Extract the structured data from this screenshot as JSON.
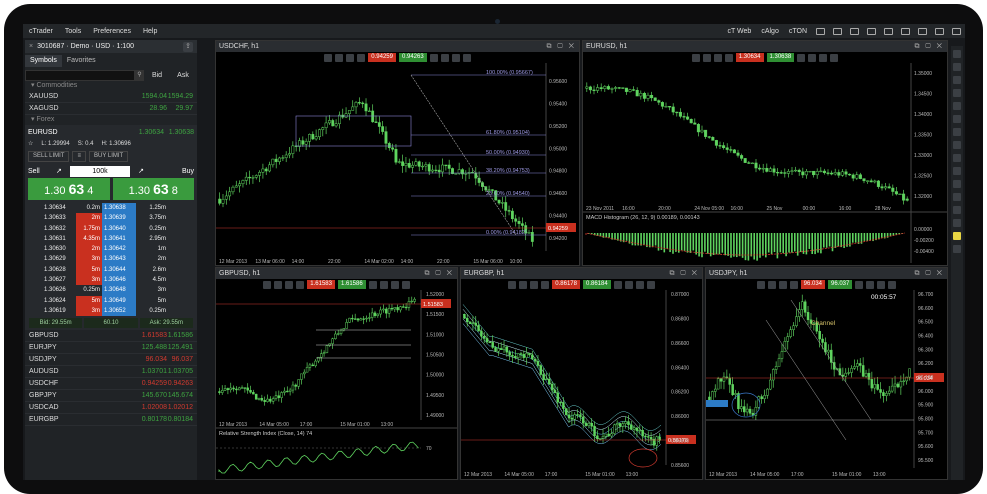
{
  "menu": {
    "ctrader": "cTrader",
    "tools": "Tools",
    "prefs": "Preferences",
    "help": "Help",
    "ctweb": "cT Web",
    "calgo": "cAlgo",
    "cton": "cTON"
  },
  "account": {
    "label": "3010687 · Demo · USD · 1:100"
  },
  "tabs": {
    "symbols": "Symbols",
    "favorites": "Favorites"
  },
  "search": {
    "placeholder": "",
    "bid": "Bid",
    "ask": "Ask"
  },
  "groups": {
    "commodities": "▾ Commodities",
    "forex": "▾ Forex"
  },
  "commodities": [
    {
      "name": "XAUUSD",
      "bid": "1594.04",
      "ask": "1594.29"
    },
    {
      "name": "XAGUSD",
      "bid": "28.96",
      "ask": "29.97"
    }
  ],
  "eurusd": {
    "name": "EURUSD",
    "bid": "1.30634",
    "ask": "1.30638",
    "low": "L: 1.29994",
    "spread": "S: 0.4",
    "high": "H: 1.30696",
    "sell_limit": "SELL LIMIT",
    "buy_limit": "BUY LIMIT",
    "sell": "Sell",
    "buy": "Buy",
    "qty": "100k",
    "bigsell_pre": "1.30",
    "bigsell_mid": "63",
    "bigsell_post": "4",
    "bigbuy_pre": "1.30",
    "bigbuy_mid": "63",
    "bigbuy_post": "8"
  },
  "ladder": [
    {
      "bpx": "1.30634",
      "bvol": "0.2m",
      "apx": "1.30638",
      "avol": "1.25m",
      "bred": false
    },
    {
      "bpx": "1.30633",
      "bvol": "2m",
      "apx": "1.30639",
      "avol": "3.75m",
      "bred": true
    },
    {
      "bpx": "1.30632",
      "bvol": "1.75m",
      "apx": "1.30640",
      "avol": "0.25m",
      "bred": true
    },
    {
      "bpx": "1.30631",
      "bvol": "4.35m",
      "apx": "1.30641",
      "avol": "2.95m",
      "bred": true
    },
    {
      "bpx": "1.30630",
      "bvol": "2m",
      "apx": "1.30642",
      "avol": "1m",
      "bred": true
    },
    {
      "bpx": "1.30629",
      "bvol": "3m",
      "apx": "1.30643",
      "avol": "2m",
      "bred": true
    },
    {
      "bpx": "1.30628",
      "bvol": "5m",
      "apx": "1.30644",
      "avol": "2.6m",
      "bred": true
    },
    {
      "bpx": "1.30627",
      "bvol": "3m",
      "apx": "1.30646",
      "avol": "4.5m",
      "bred": true
    },
    {
      "bpx": "1.30626",
      "bvol": "0.25m",
      "apx": "1.30648",
      "avol": "3m",
      "bred": false
    },
    {
      "bpx": "1.30624",
      "bvol": "5m",
      "apx": "1.30649",
      "avol": "5m",
      "bred": true
    },
    {
      "bpx": "1.30619",
      "bvol": "3m",
      "apx": "1.30652",
      "avol": "0.25m",
      "bred": true
    }
  ],
  "spread": {
    "bid": "Bid: 29.55m",
    "mid": "60.10",
    "ask": "Ask: 29.55m"
  },
  "forex": [
    {
      "name": "GBPUSD",
      "bid": "1.61583",
      "ask": "1.61586",
      "bc": "rd",
      "ac": "gr"
    },
    {
      "name": "EURJPY",
      "bid": "125.488",
      "ask": "125.491",
      "bc": "gr",
      "ac": "gr"
    },
    {
      "name": "USDJPY",
      "bid": "96.034",
      "ask": "96.037",
      "bc": "rd",
      "ac": "rd"
    },
    {
      "name": "AUDUSD",
      "bid": "1.03701",
      "ask": "1.03705",
      "bc": "gr",
      "ac": "gr"
    },
    {
      "name": "USDCHF",
      "bid": "0.94259",
      "ask": "0.94263",
      "bc": "rd",
      "ac": "rd"
    },
    {
      "name": "GBPJPY",
      "bid": "145.670",
      "ask": "145.674",
      "bc": "gr",
      "ac": "gr"
    },
    {
      "name": "USDCAD",
      "bid": "1.02008",
      "ask": "1.02012",
      "bc": "rd",
      "ac": "rd"
    },
    {
      "name": "EURGBP",
      "bid": "0.80178",
      "ask": "0.80184",
      "bc": "gr",
      "ac": "gr"
    }
  ],
  "charts": {
    "usdchf": {
      "title": "USDCHF, h1",
      "sell": "0.94259",
      "buy": "0.94263",
      "ticks": [
        "0.95600",
        "0.95400",
        "0.95200",
        "0.95000",
        "0.94800",
        "0.94600",
        "0.94400",
        "0.94200"
      ],
      "times": [
        "12 Mar 2013",
        "13 Mar 06:00",
        "14:00",
        "22:00",
        "14 Mar 02:00",
        "14:00",
        "22:00",
        "15 Mar 06:00",
        "10:00"
      ],
      "fib": [
        "100.00% (0.95667)",
        "61.80% (0.95104)",
        "50.00% (0.94930)",
        "38.20% (0.94753)",
        "23.60% (0.94540)",
        "0.00% (0.94182)"
      ],
      "price": "0.94259"
    },
    "eurusd": {
      "title": "EURUSD, h1",
      "sell": "1.30634",
      "buy": "1.30638",
      "ticks": [
        "1.35000",
        "1.34500",
        "1.34000",
        "1.33500",
        "1.33000",
        "1.32500",
        "1.32000"
      ],
      "times": [
        "23 Nov 2011",
        "16:00",
        "20:00",
        "24 Nov 05:00",
        "16:00",
        "25 Nov",
        "00:00",
        "16:00",
        "28 Nov"
      ],
      "macd": "MACD Histogram (26, 12, 9) 0.00189, 0.00143",
      "mticks": [
        "0.00000",
        "-0.00200",
        "-0.00400"
      ]
    },
    "gbpusd": {
      "title": "GBPUSD, h1",
      "sell": "1.61583",
      "buy": "1.61586",
      "ticks": [
        "1.52000",
        "1.51500",
        "1.51000",
        "1.50500",
        "1.50000",
        "1.49500",
        "1.49000"
      ],
      "times": [
        "12 Mar 2013",
        "14 Mar 05:00",
        "17:00",
        "15 Mar 01:00",
        "13:00"
      ],
      "price": "1.51583",
      "rsi": "Relative Strength Index (Close, 14) 74",
      "rsi70": "70"
    },
    "eurgbp": {
      "title": "EURGBP, h1",
      "sell": "0.86178",
      "buy": "0.86184",
      "ticks": [
        "0.87000",
        "0.86800",
        "0.86600",
        "0.86400",
        "0.86200",
        "0.86000",
        "0.85800",
        "0.85600"
      ],
      "times": [
        "12 Mar 2013",
        "14 Mar 05:00",
        "17:00",
        "15 Mar 01:00",
        "13:00"
      ],
      "price": "0.86178"
    },
    "usdjpy": {
      "title": "USDJPY, h1",
      "sell": "96.034",
      "buy": "96.037",
      "ticks": [
        "96.700",
        "96.600",
        "96.500",
        "96.400",
        "96.300",
        "96.200",
        "96.100",
        "96.000",
        "95.900",
        "95.800",
        "95.700",
        "95.600",
        "95.500"
      ],
      "times": [
        "12 Mar 2013",
        "14 Mar 05:00",
        "17:00",
        "15 Mar 01:00",
        "13:00"
      ],
      "timer": "00:05:57",
      "channel": "Channel",
      "price": "96.034"
    }
  }
}
